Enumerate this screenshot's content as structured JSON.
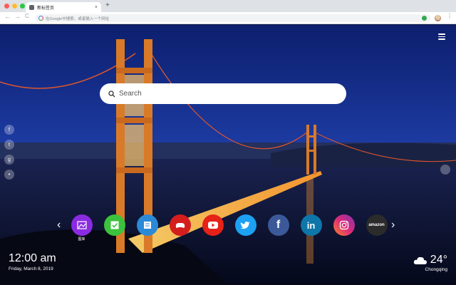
{
  "browser": {
    "tab_title": "新标签页",
    "tab_close": "×",
    "new_tab": "+",
    "omnibox_placeholder": "在Google中搜索，或者输入一个网址",
    "back": "←",
    "forward": "→",
    "reload": "C",
    "menu": "⋮"
  },
  "page": {
    "search_placeholder": "Search",
    "clock": {
      "time": "12:00 am",
      "date": "Friday, March 8, 2019"
    },
    "weather": {
      "temperature": "24°",
      "city": "Chongqing",
      "icon": "cloud-icon"
    },
    "nav": {
      "prev": "‹",
      "next": "›"
    },
    "apps": [
      {
        "name": "gallery",
        "label": "图库",
        "color": "#8a2be2",
        "icon": "image-icon"
      },
      {
        "name": "tasks",
        "label": "",
        "color": "#3cc23c",
        "icon": "check-icon"
      },
      {
        "name": "notes",
        "label": "",
        "color": "#2b8ad6",
        "icon": "note-icon"
      },
      {
        "name": "games",
        "label": "",
        "color": "#d41e1e",
        "icon": "gamepad-icon"
      },
      {
        "name": "youtube",
        "label": "",
        "color": "#e62117",
        "icon": "play-icon"
      },
      {
        "name": "twitter",
        "label": "",
        "color": "#1da1f2",
        "icon": "bird-icon"
      },
      {
        "name": "facebook",
        "label": "",
        "color": "#3b5998",
        "icon": "f-icon",
        "text": "f"
      },
      {
        "name": "linkedin",
        "label": "",
        "color": "#0e76a8",
        "icon": "in-icon",
        "text": "in"
      },
      {
        "name": "instagram",
        "label": "",
        "color": "#d6249f",
        "icon": "camera-icon"
      },
      {
        "name": "amazon",
        "label": "",
        "color": "#2b2b2b",
        "icon": "amazon-icon",
        "text": "amazon"
      }
    ]
  }
}
